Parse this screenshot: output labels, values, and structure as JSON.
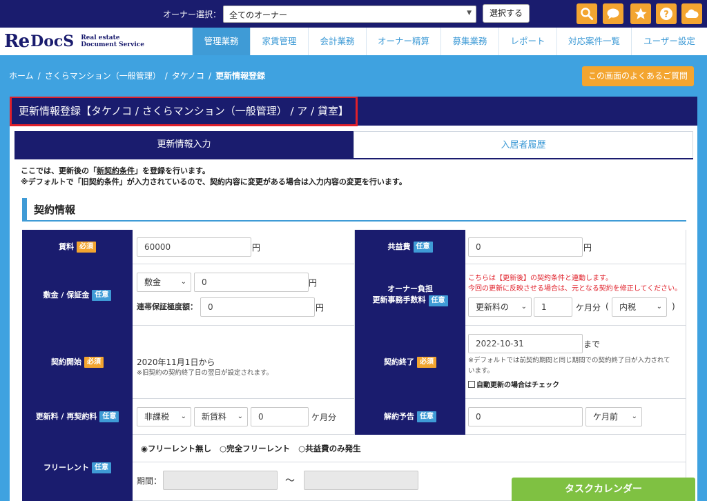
{
  "topbar": {
    "owner_label": "オーナー選択：",
    "owner_selected": "全てのオーナー",
    "select_button": "選択する",
    "icons": [
      "search-icon",
      "chat-icon",
      "star-icon",
      "help-icon",
      "cloud-icon"
    ],
    "icon_color": "#f3a530"
  },
  "brand": {
    "logo_main_1": "Re",
    "logo_main_2": "DocS",
    "logo_sub_1": "Real estate",
    "logo_sub_2": "Document Service"
  },
  "nav": {
    "items": [
      "管理業務",
      "家賃管理",
      "会計業務",
      "オーナー精算",
      "募集業務",
      "レポート",
      "対応案件一覧",
      "ユーザー設定"
    ],
    "active_index": 0
  },
  "breadcrumb": {
    "items": [
      "ホーム",
      "さくらマンション（一般管理）",
      "タケノコ"
    ],
    "current": "更新情報登録",
    "separator": "/"
  },
  "faq_button": "この画面のよくあるご質問",
  "panel": {
    "title": "更新情報登録【タケノコ / さくらマンション（一般管理） / ア / 貸室】",
    "tabs": [
      "更新情報入力",
      "入居者履歴"
    ],
    "intro_line1_a": "ここでは、更新後の「",
    "intro_line1_u": "新契約条件",
    "intro_line1_b": "」を登録を行います。",
    "intro_line2": "※デフォルトで「旧契約条件」が入力されているので、契約内容に変更がある場合は入力内容の変更を行います。",
    "section_title": "契約情報"
  },
  "badges": {
    "required": "必須",
    "optional": "任意"
  },
  "form": {
    "rent": {
      "label": "賃料",
      "value": "60000",
      "unit": "円"
    },
    "common_fee": {
      "label": "共益費",
      "value": "0",
      "unit": "円"
    },
    "deposit": {
      "label": "敷金 / 保証金",
      "type_selected": "敷金",
      "value": "0",
      "unit": "円",
      "joint_label": "連帯保証極度額：",
      "joint_value": "0",
      "joint_unit": "円"
    },
    "owner_fee": {
      "label_1": "オーナー負担",
      "label_2": "更新事務手数料",
      "note_1": "こちらは【更新後】の契約条件と連動します。",
      "note_2": "今回の更新に反映させる場合は、元となる契約を修正してください。",
      "base_selected": "更新料の",
      "value": "1",
      "months_unit": "ケ月分",
      "paren_open": "(",
      "paren_close": ")",
      "tax_selected": "内税"
    },
    "start": {
      "label": "契約開始",
      "value": "2020年11月1日から",
      "note": "※旧契約の契約終了日の翌日が設定されます。"
    },
    "end": {
      "label": "契約終了",
      "value": "2022-10-31",
      "until": "まで",
      "note_1": "※デフォルトでは前契約期間と同じ期間での契約終了日が入力されて",
      "note_2": "います。",
      "auto_renew": "自動更新の場合はチェック"
    },
    "renewal_fee": {
      "label": "更新料 / 再契約料",
      "tax_selected": "非課税",
      "base_selected": "新賃料",
      "value": "0",
      "unit": "ケ月分"
    },
    "notice": {
      "label": "解約予告",
      "value": "0",
      "unit_selected": "ケ月前"
    },
    "free_rent": {
      "label": "フリーレント",
      "options": [
        "フリーレント無し",
        "完全フリーレント",
        "共益費のみ発生"
      ],
      "selected_index": 0,
      "period_label": "期間：",
      "tilde": "～"
    }
  },
  "task_calendar": "タスクカレンダー"
}
